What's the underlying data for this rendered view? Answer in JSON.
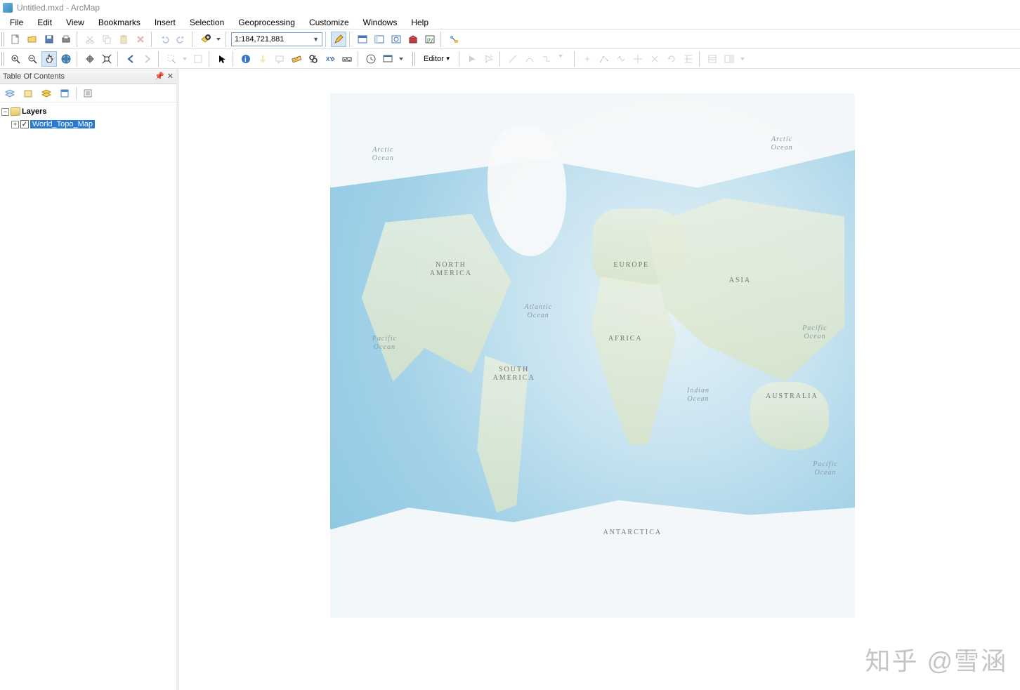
{
  "title": "Untitled.mxd - ArcMap",
  "menus": [
    "File",
    "Edit",
    "View",
    "Bookmarks",
    "Insert",
    "Selection",
    "Geoprocessing",
    "Customize",
    "Windows",
    "Help"
  ],
  "scale_value": "1:184,721,881",
  "editor_label": "Editor",
  "toc": {
    "title": "Table Of Contents",
    "root_label": "Layers",
    "layer_name": "World_Topo_Map"
  },
  "maplabels": {
    "arctic_l": "Arctic\nOcean",
    "arctic_r": "Arctic\nOcean",
    "pacific_l": "Pacific\nOcean",
    "pacific_r": "Pacific\nOcean",
    "pacific_br": "Pacific\nOcean",
    "atlantic": "Atlantic\nOcean",
    "indian": "Indian\nOcean",
    "na": "NORTH\nAMERICA",
    "sa": "SOUTH\nAMERICA",
    "eu": "EUROPE",
    "af": "AFRICA",
    "as": "ASIA",
    "au": "AUSTRALIA",
    "ant": "ANTARCTICA"
  },
  "watermark": "知乎 @雪涵"
}
